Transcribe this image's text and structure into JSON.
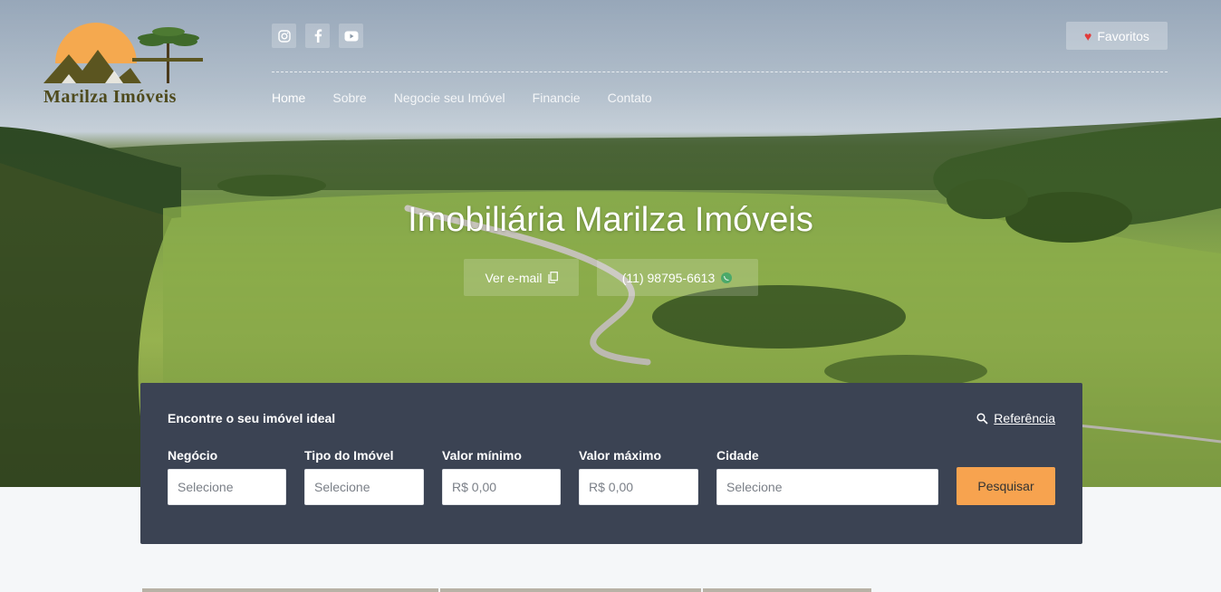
{
  "brand": {
    "name": "Marilza Imóveis"
  },
  "social": {
    "icons": [
      "instagram-icon",
      "facebook-icon",
      "youtube-icon"
    ]
  },
  "favorites": {
    "label": "Favoritos"
  },
  "nav": {
    "items": [
      {
        "label": "Home"
      },
      {
        "label": "Sobre"
      },
      {
        "label": "Negocie seu Imóvel"
      },
      {
        "label": "Financie"
      },
      {
        "label": "Contato"
      }
    ]
  },
  "hero": {
    "title": "Imobiliária Marilza Imóveis",
    "email_label": "Ver e-mail",
    "phone": "(11) 98795-6613"
  },
  "search": {
    "title": "Encontre o seu imóvel ideal",
    "reference_label": "Referência",
    "fields": {
      "negocio": {
        "label": "Negócio",
        "placeholder": "Selecione"
      },
      "tipo": {
        "label": "Tipo do Imóvel",
        "placeholder": "Selecione"
      },
      "valor_min": {
        "label": "Valor mínimo",
        "placeholder": "R$ 0,00"
      },
      "valor_max": {
        "label": "Valor máximo",
        "placeholder": "R$ 0,00"
      },
      "cidade": {
        "label": "Cidade",
        "placeholder": "Selecione"
      }
    },
    "button_label": "Pesquisar"
  },
  "colors": {
    "panel": "#3b4353",
    "accent": "#f7a34f",
    "heart": "#e23b3b",
    "logo_text": "#4e4a1c",
    "logo_sun": "#f5a94f"
  }
}
